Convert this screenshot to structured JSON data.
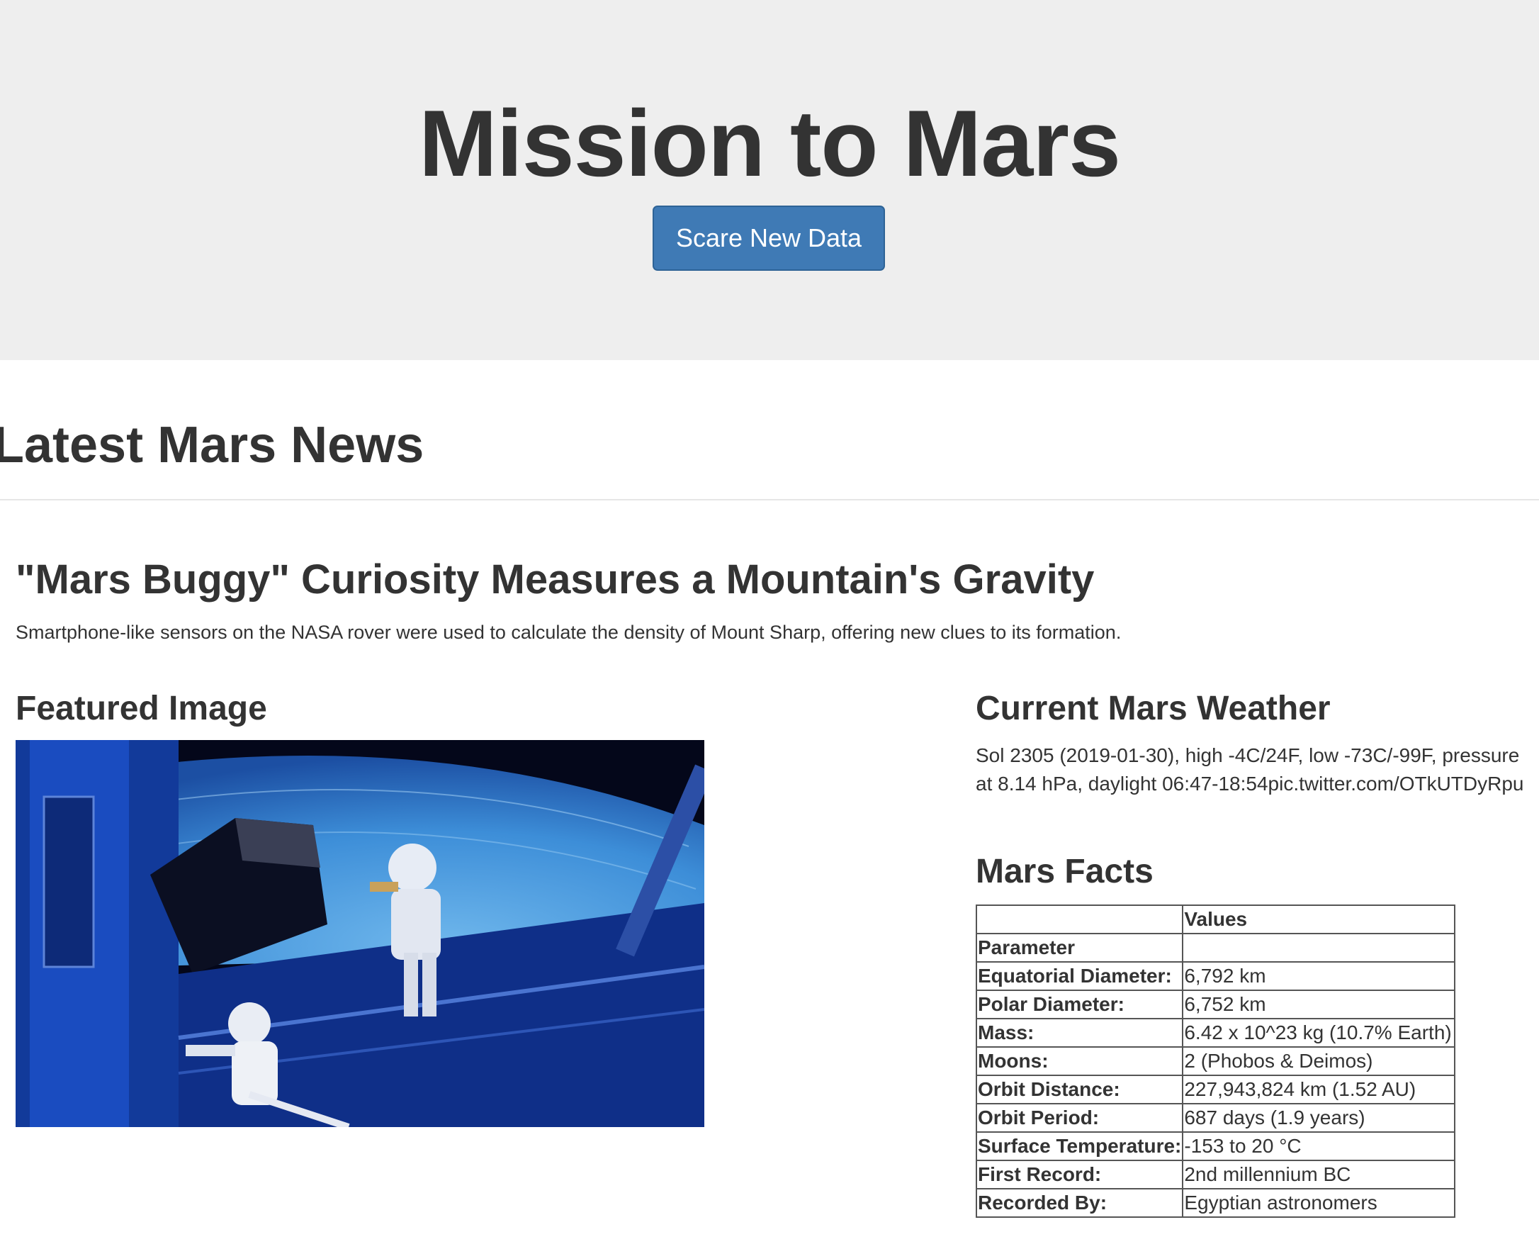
{
  "header": {
    "title": "Mission to Mars",
    "scrape_button_label": "Scare New Data"
  },
  "news": {
    "section_heading": "Latest Mars News",
    "title": "\"Mars Buggy\" Curiosity Measures a Mountain's Gravity",
    "teaser": "Smartphone-like sensors on the NASA rover were used to calculate the density of Mount Sharp, offering new clues to its formation."
  },
  "featured": {
    "heading": "Featured Image",
    "image_alt": "Astronauts servicing a spacecraft in orbit above Earth"
  },
  "weather": {
    "heading": "Current Mars Weather",
    "text": "Sol 2305 (2019-01-30), high -4C/24F, low -73C/-99F, pressure at 8.14 hPa, daylight 06:47-18:54pic.twitter.com/OTkUTDyRpu"
  },
  "facts": {
    "heading": "Mars Facts",
    "header_row": [
      "",
      "Values"
    ],
    "index_label": "Parameter",
    "rows": [
      {
        "parameter": "Equatorial Diameter:",
        "value": "6,792 km"
      },
      {
        "parameter": "Polar Diameter:",
        "value": "6,752 km"
      },
      {
        "parameter": "Mass:",
        "value": "6.42 x 10^23 kg (10.7% Earth)"
      },
      {
        "parameter": "Moons:",
        "value": "2 (Phobos & Deimos)"
      },
      {
        "parameter": "Orbit Distance:",
        "value": "227,943,824 km (1.52 AU)"
      },
      {
        "parameter": "Orbit Period:",
        "value": "687 days (1.9 years)"
      },
      {
        "parameter": "Surface Temperature:",
        "value": "-153 to 20 °C"
      },
      {
        "parameter": "First Record:",
        "value": "2nd millennium BC"
      },
      {
        "parameter": "Recorded By:",
        "value": "Egyptian astronomers"
      }
    ]
  },
  "colors": {
    "jumbotron_bg": "#eeeeee",
    "button_bg": "#3f7ab5",
    "text": "#333333"
  }
}
